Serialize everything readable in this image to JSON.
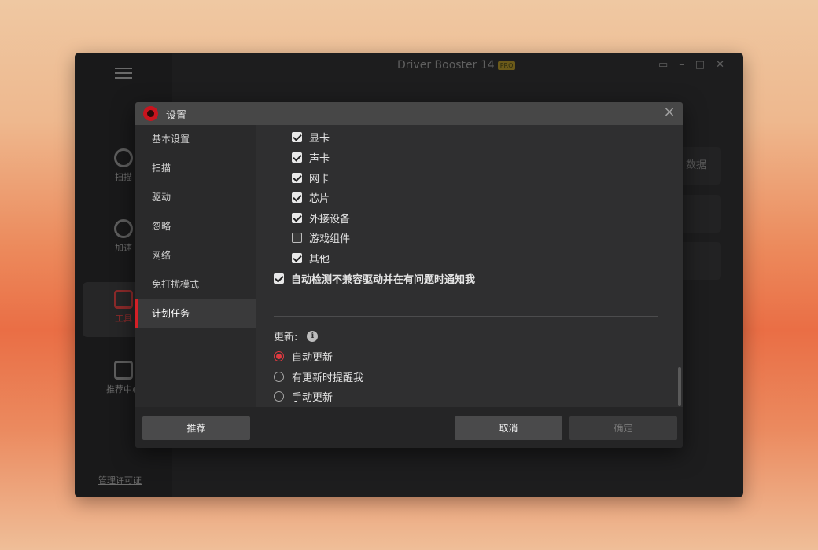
{
  "app": {
    "title": "Driver Booster 14",
    "badge": "PRO",
    "license_link": "管理许可证",
    "side_nav": [
      {
        "label": "扫描",
        "icon": "scan-icon"
      },
      {
        "label": "加速",
        "icon": "speedometer-icon"
      },
      {
        "label": "工具",
        "icon": "toolbox-icon"
      },
      {
        "label": "推荐中心",
        "icon": "apps-icon"
      }
    ],
    "bg_card_text": "数据"
  },
  "dialog": {
    "title": "设置",
    "nav": [
      {
        "label": "基本设置"
      },
      {
        "label": "扫描"
      },
      {
        "label": "驱动"
      },
      {
        "label": "忽略"
      },
      {
        "label": "网络"
      },
      {
        "label": "免打扰模式"
      },
      {
        "label": "计划任务",
        "active": true
      }
    ],
    "device_checkboxes": [
      {
        "label": "显卡",
        "checked": true
      },
      {
        "label": "声卡",
        "checked": true
      },
      {
        "label": "网卡",
        "checked": true
      },
      {
        "label": "芯片",
        "checked": true
      },
      {
        "label": "外接设备",
        "checked": true
      },
      {
        "label": "游戏组件",
        "checked": false
      },
      {
        "label": "其他",
        "checked": true
      }
    ],
    "auto_detect": {
      "label": "自动检测不兼容驱动并在有问题时通知我",
      "checked": true
    },
    "update": {
      "label": "更新:",
      "options": [
        {
          "label": "自动更新",
          "selected": true
        },
        {
          "label": "有更新时提醒我",
          "selected": false
        },
        {
          "label": "手动更新",
          "selected": false
        }
      ]
    },
    "footer": {
      "recommend": "推荐",
      "cancel": "取消",
      "ok": "确定"
    }
  },
  "colors": {
    "accent": "#e13a40",
    "dialog_bg": "#2f2f30",
    "header_bg": "#474747"
  }
}
